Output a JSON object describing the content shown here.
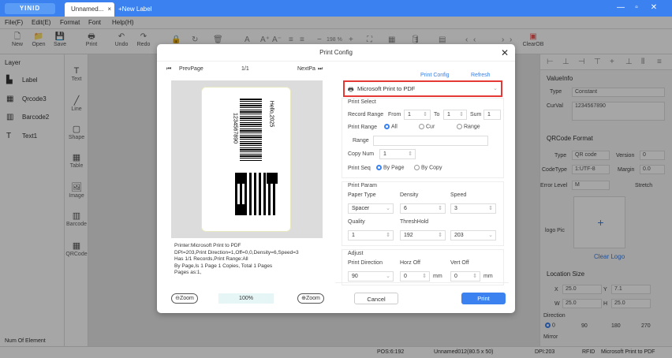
{
  "app": {
    "logo": "YINID",
    "tab_title": "Unnamed...",
    "tab_close": "×",
    "new_label": "+New Label"
  },
  "menu": [
    "File(F)",
    "Edit(E)",
    "Format",
    "Font",
    "Help(H)"
  ],
  "toolbar": {
    "new": "New",
    "open": "Open",
    "save": "Save",
    "print": "Print",
    "undo": "Undo",
    "redo": "Redo",
    "zoom": "198 %",
    "clearob": "ClearOB"
  },
  "layer": {
    "header": "Layer",
    "items": [
      "Label",
      "Qrcode3",
      "Barcode2",
      "Text1"
    ],
    "num_of_element": "Num Of Element"
  },
  "tools": [
    "Text",
    "Line",
    "Shape",
    "Table",
    "Image",
    "Barcode",
    "QRCode"
  ],
  "right": {
    "valueinfo": "ValueInfo",
    "type_label": "Type",
    "type_value": "Constant",
    "curval_label": "CurVal",
    "curval_value": "1234567890",
    "qrformat": "QRCode Format",
    "qr_type_label": "Type",
    "qr_type_value": "QR code",
    "version_label": "Version",
    "version_value": "0",
    "codetype_label": "CodeType",
    "codetype_value": "1:UTF-8",
    "margin_label": "Margin",
    "margin_value": "0.0",
    "error_label": "Error Level",
    "error_value": "M",
    "stretch": "Stretch",
    "logo_label": "logo Pic",
    "clear_logo": "Clear Logo",
    "location": "Location Size",
    "x_label": "X",
    "x_value": "25.0",
    "y_label": "Y",
    "y_value": "7.1",
    "w_label": "W",
    "w_value": "25.0",
    "h_label": "H",
    "h_value": "25.0",
    "direction": "Direction",
    "dir_0": "0",
    "dir_90": "90",
    "dir_180": "180",
    "dir_270": "270",
    "mirror": "Mirror"
  },
  "status": {
    "pos": "POS:6:192",
    "file": "Unnamed012(80.5 x 50)",
    "dpi": "DPI:203",
    "rfid": "RFID",
    "printer": "Microsoft Print to PDF"
  },
  "dialog": {
    "title": "Print Config",
    "close": "✕",
    "prev": "PrevPage",
    "page": "1/1",
    "next": "NextPa",
    "label_text": "Hello,2025",
    "label_number": "1234567890",
    "info_lines": [
      "Printer:Microsoft Print to PDF",
      "DPI=203,Print Direction=1,Off=0,0,Density=6,Speed=3",
      "Has 1/1 Records,Print Range:All",
      "By Page,Is 1 Page 1 Copies,  Total 1 Pages",
      "Pages as:1,"
    ],
    "zoom_out": "Zoom",
    "zoom_in": "Zoom",
    "zoom_pct": "100%",
    "print_config_link": "Print Config",
    "refresh_link": "Refresh",
    "printer": "Microsoft Print to PDF",
    "print_select": "Print Select",
    "record_range": "Record Range",
    "from_label": "From",
    "from_value": "1",
    "to_label": "To",
    "to_value": "1",
    "sum_label": "Sum",
    "sum_value": "1",
    "print_range": "Print Range",
    "range_all": "All",
    "range_cur": "Cur",
    "range_range": "Range",
    "range_label": "Range",
    "copy_num": "Copy Num",
    "copy_value": "1",
    "print_seq": "Print Seq",
    "by_page": "By Page",
    "by_copy": "By Copy",
    "print_param": "Print Param",
    "paper_type": "Paper Type",
    "paper_value": "Spacer",
    "density": "Density",
    "density_value": "6",
    "speed": "Speed",
    "speed_value": "3",
    "quality": "Quality",
    "quality_value": "1",
    "threshhold": "ThreshHold",
    "threshhold_value": "192",
    "dpi_value": "203",
    "adjust": "Adjust",
    "print_direction": "Print Direction",
    "direction_value": "90",
    "horz_off": "Horz Off",
    "horz_value": "0",
    "vert_off": "Vert Off",
    "vert_value": "0",
    "mm": "mm",
    "cancel": "Cancel",
    "print": "Print"
  },
  "colors": {
    "accent": "#3b82f0",
    "highlight": "#e53935",
    "link": "#3b7de0"
  }
}
